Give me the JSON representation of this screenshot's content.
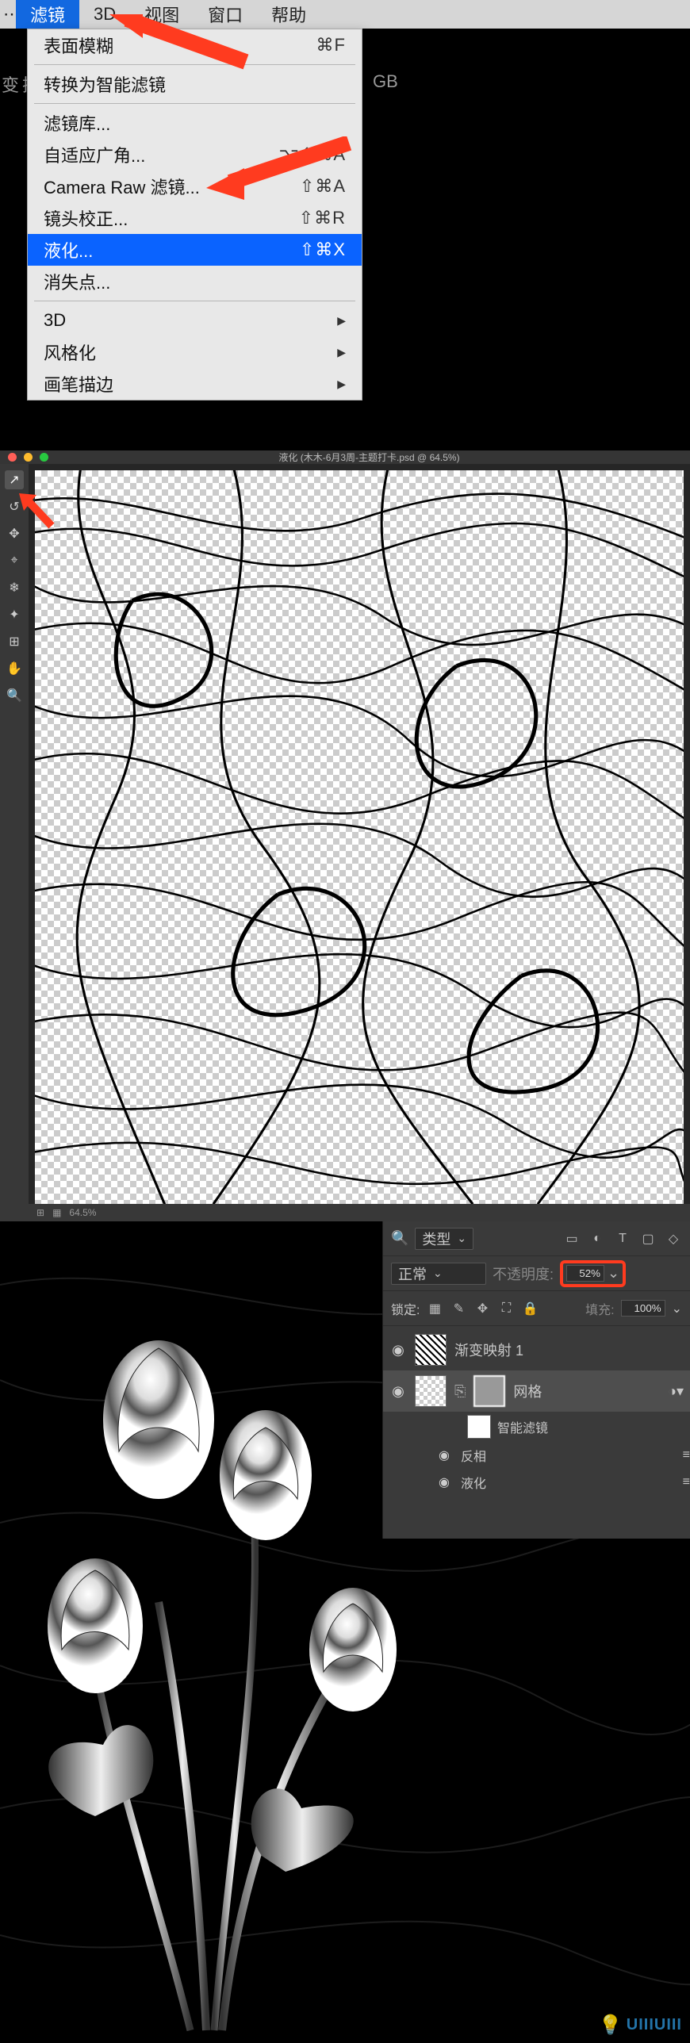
{
  "menubar": {
    "items": [
      "滤镜",
      "3D",
      "视图",
      "窗口",
      "帮助"
    ],
    "selected_index": 0
  },
  "bg_left": "变换",
  "bg_right": "GB",
  "dropdown": {
    "last_filter": {
      "label": "表面模糊",
      "shortcut": "⌘F"
    },
    "smart": "转换为智能滤镜",
    "group1": [
      {
        "label": "滤镜库...",
        "shortcut": ""
      },
      {
        "label": "自适应广角...",
        "shortcut": "⌥⇧⌘A"
      },
      {
        "label": "Camera Raw 滤镜...",
        "shortcut": "⇧⌘A"
      },
      {
        "label": "镜头校正...",
        "shortcut": "⇧⌘R"
      },
      {
        "label": "液化...",
        "shortcut": "⇧⌘X",
        "hl": true
      },
      {
        "label": "消失点...",
        "shortcut": ""
      }
    ],
    "group2": [
      "3D",
      "风格化",
      "画笔描边"
    ]
  },
  "liquify": {
    "title": "液化 (木木-6月3周-主题打卡.psd @ 64.5%)",
    "zoom": "64.5%",
    "tools": [
      "↗",
      "↺",
      "✥",
      "⌖",
      "❄",
      "✦",
      "⊞",
      "✋",
      "🔍"
    ]
  },
  "layers": {
    "type_label": "类型",
    "filter_icons": [
      "▭",
      "◐",
      "T",
      "▢",
      "◇"
    ],
    "blend": "正常",
    "opacity_label": "不透明度:",
    "opacity_value": "52%",
    "lock_label": "锁定:",
    "lock_icons": [
      "▦",
      "✎",
      "✥",
      "⛶",
      "🔒"
    ],
    "fill_label": "填充:",
    "fill_value": "100%",
    "items": [
      {
        "name": "渐变映射 1",
        "thumb": "swirl"
      },
      {
        "name": "网格",
        "thumb": "checker",
        "mask": true,
        "selected": true,
        "fx": true
      },
      {
        "name_smart": "智能滤镜"
      },
      {
        "fx_item": "反相",
        "edit": "≡"
      },
      {
        "fx_item": "液化",
        "edit": "≡"
      }
    ]
  },
  "watermark": "UIIIUIII"
}
